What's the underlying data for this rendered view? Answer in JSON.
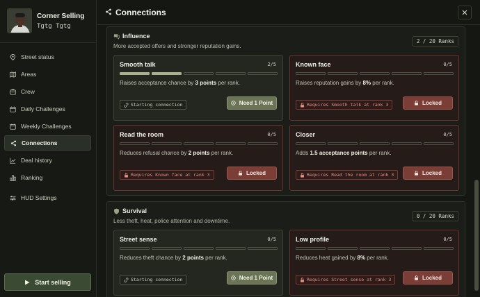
{
  "profile": {
    "name": "Corner Selling",
    "subtitle": "Tgtg Tgtg"
  },
  "nav": {
    "items": [
      {
        "label": "Street status",
        "icon": "location-icon"
      },
      {
        "label": "Areas",
        "icon": "map-icon"
      },
      {
        "label": "Crew",
        "icon": "crew-icon"
      },
      {
        "label": "Daily Challenges",
        "icon": "calendar-icon"
      },
      {
        "label": "Weekly Challenges",
        "icon": "calendar-icon"
      },
      {
        "label": "Connections",
        "icon": "share-icon",
        "active": true
      },
      {
        "label": "Deal history",
        "icon": "chart-icon"
      },
      {
        "label": "Ranking",
        "icon": "ranking-icon"
      },
      {
        "label": "HUD Settings",
        "icon": "sliders-icon"
      }
    ],
    "start_label": "Start selling"
  },
  "header": {
    "title": "Connections",
    "close_icon": "close-icon"
  },
  "sections": [
    {
      "title": "Influence",
      "description": "More accepted offers and stronger reputation gains.",
      "ranks": "2 / 20 Ranks",
      "cards": [
        {
          "title": "Smooth talk",
          "count": "2/5",
          "progress": 2,
          "max": 5,
          "desc_pre": "Raises acceptance chance by ",
          "desc_bold": "3 points",
          "desc_post": " per rank.",
          "chip": "Starting connection",
          "chip_type": "start",
          "action": "Need 1 Point",
          "action_type": "need"
        },
        {
          "title": "Known face",
          "count": "0/5",
          "progress": 0,
          "max": 5,
          "desc_pre": "Raises reputation gains by ",
          "desc_bold": "8%",
          "desc_post": " per rank.",
          "chip": "Requires Smooth talk at rank 3",
          "chip_type": "req",
          "action": "Locked",
          "action_type": "lock"
        },
        {
          "title": "Read the room",
          "count": "0/5",
          "progress": 0,
          "max": 5,
          "desc_pre": "Reduces refusal chance by ",
          "desc_bold": "2 points",
          "desc_post": " per rank.",
          "chip": "Requires Known face at rank 3",
          "chip_type": "req",
          "action": "Locked",
          "action_type": "lock"
        },
        {
          "title": "Closer",
          "count": "0/5",
          "progress": 0,
          "max": 5,
          "desc_pre": "Adds ",
          "desc_bold": "1.5 acceptance points",
          "desc_post": " per rank.",
          "chip": "Requires Read the room at rank 3",
          "chip_type": "req",
          "action": "Locked",
          "action_type": "lock"
        }
      ]
    },
    {
      "title": "Survival",
      "description": "Less theft, heat, police attention and downtime.",
      "ranks": "0 / 20 Ranks",
      "cards": [
        {
          "title": "Street sense",
          "count": "0/5",
          "progress": 0,
          "max": 5,
          "desc_pre": "Reduces theft chance by ",
          "desc_bold": "2 points",
          "desc_post": " per rank.",
          "chip": "Starting connection",
          "chip_type": "start",
          "action": "Need 1 Point",
          "action_type": "need"
        },
        {
          "title": "Low profile",
          "count": "0/5",
          "progress": 0,
          "max": 5,
          "desc_pre": "Reduces heat gained by ",
          "desc_bold": "8%",
          "desc_post": " per rank.",
          "chip": "Requires Street sense at rank 3",
          "chip_type": "req",
          "action": "Locked",
          "action_type": "lock"
        }
      ]
    }
  ],
  "colors": {
    "accent": "#a7b18e",
    "locked": "#7a3e37",
    "locked_text": "#e48f83"
  }
}
